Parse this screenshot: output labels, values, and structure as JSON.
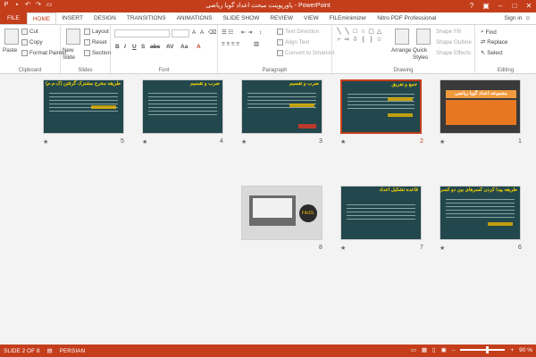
{
  "window": {
    "title": "پاورپوینت مبحث اعداد گویا ریاضی - PowerPoint"
  },
  "tabs": [
    "FILE",
    "HOME",
    "INSERT",
    "DESIGN",
    "TRANSITIONS",
    "ANIMATIONS",
    "SLIDE SHOW",
    "REVIEW",
    "VIEW",
    "FILEminimizer",
    "Nitro PDF Professional"
  ],
  "signin": "Sign in",
  "ribbon": {
    "clipboard": {
      "paste": "Paste",
      "cut": "Cut",
      "copy": "Copy",
      "format_painter": "Format Painter",
      "label": "Clipboard"
    },
    "slides": {
      "new_slide": "New Slide",
      "layout": "Layout",
      "reset": "Reset",
      "section": "Section",
      "label": "Slides"
    },
    "font": {
      "label": "Font"
    },
    "paragraph": {
      "text_direction": "Text Direction",
      "align_text": "Align Text",
      "convert_smartart": "Convert to SmartArt",
      "label": "Paragraph"
    },
    "drawing": {
      "arrange": "Arrange",
      "quick_styles": "Quick Styles",
      "shape_fill": "Shape Fill",
      "shape_outline": "Shape Outline",
      "shape_effects": "Shape Effects",
      "label": "Drawing"
    },
    "editing": {
      "find": "Find",
      "replace": "Replace",
      "select": "Select",
      "label": "Editing"
    }
  },
  "slides": [
    {
      "num": "5",
      "title": "طریقه مخرج مشترک گرفتن (ک.م.م)"
    },
    {
      "num": "4",
      "title": "ضرب و تقسیم"
    },
    {
      "num": "3",
      "title": "ضرب و تقسیم"
    },
    {
      "num": "2",
      "title": "جمع و تفریق"
    },
    {
      "num": "1",
      "title": "مجموعه اعداد گویا ریاضی"
    },
    {
      "num": "8",
      "title": ""
    },
    {
      "num": "7",
      "title": "قاعده تشکیل اعداد"
    },
    {
      "num": "6",
      "title": "طریقه پیدا کردن کسرهای بین دو کسر"
    }
  ],
  "slide8_logo": "FileDL",
  "status": {
    "slide": "SLIDE 2 OF 8",
    "language": "PERSIAN",
    "zoom": "90 %",
    "zoom_fraction": 0.6
  },
  "colors": {
    "accent": "#c43e1c",
    "slide_bg": "#22474d",
    "title_yellow": "#f3d000",
    "orange": "#e87722"
  }
}
